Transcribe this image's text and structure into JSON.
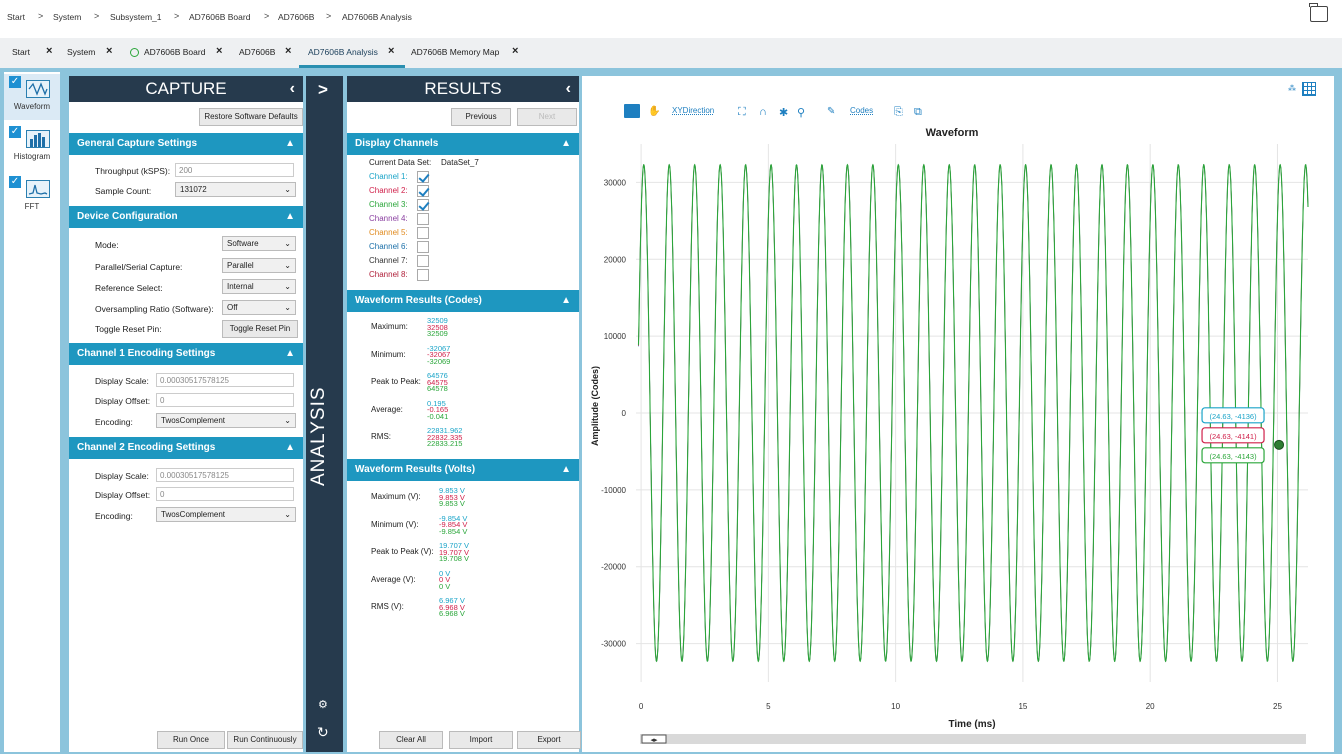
{
  "breadcrumb": [
    "Start",
    "System",
    "Subsystem_1",
    "AD7606B Board",
    "AD7606B",
    "AD7606B Analysis"
  ],
  "tabs": [
    {
      "label": "Start"
    },
    {
      "label": "System"
    },
    {
      "label": "AD7606B Board"
    },
    {
      "label": "AD7606B"
    },
    {
      "label": "AD7606B Analysis"
    },
    {
      "label": "AD7606B Memory Map"
    }
  ],
  "leftnav": [
    {
      "label": "Waveform",
      "icon": "waveform-icon"
    },
    {
      "label": "Histogram",
      "icon": "histogram-icon"
    },
    {
      "label": "FFT",
      "icon": "fft-icon"
    }
  ],
  "capture": {
    "title": "CAPTURE",
    "restore_label": "Restore Software Defaults",
    "general": {
      "title": "General Capture Settings",
      "throughput_label": "Throughput (kSPS):",
      "throughput_value": "200",
      "sample_count_label": "Sample Count:",
      "sample_count_value": "131072"
    },
    "device": {
      "title": "Device Configuration",
      "mode_label": "Mode:",
      "mode_value": "Software",
      "ps_label": "Parallel/Serial Capture:",
      "ps_value": "Parallel",
      "ref_label": "Reference Select:",
      "ref_value": "Internal",
      "osr_label": "Oversampling Ratio (Software):",
      "osr_value": "Off",
      "reset_label": "Toggle Reset Pin:",
      "reset_button": "Toggle Reset Pin"
    },
    "ch1": {
      "title": "Channel 1 Encoding Settings",
      "scale_label": "Display Scale:",
      "scale_value": "0.00030517578125",
      "offset_label": "Display Offset:",
      "offset_value": "0",
      "encoding_label": "Encoding:",
      "encoding_value": "TwosComplement"
    },
    "ch2": {
      "title": "Channel 2 Encoding Settings",
      "scale_label": "Display Scale:",
      "scale_value": "0.00030517578125",
      "offset_label": "Display Offset:",
      "offset_value": "0",
      "encoding_label": "Encoding:",
      "encoding_value": "TwosComplement"
    },
    "run_once": "Run Once",
    "run_continuously": "Run Continuously"
  },
  "analysis": {
    "label": "ANALYSIS",
    "expand": ">"
  },
  "results": {
    "title": "RESULTS",
    "previous": "Previous",
    "next": "Next",
    "display_channels": {
      "title": "Display Channels",
      "dataset_label": "Current Data Set:",
      "dataset_value": "DataSet_7",
      "channels": [
        {
          "label": "Channel 1:",
          "checked": true,
          "color": "#1aa4c8"
        },
        {
          "label": "Channel 2:",
          "checked": true,
          "color": "#d0204a"
        },
        {
          "label": "Channel 3:",
          "checked": true,
          "color": "#2aa63a"
        },
        {
          "label": "Channel 4:",
          "checked": false,
          "color": "#8a3fa0"
        },
        {
          "label": "Channel 5:",
          "checked": false,
          "color": "#e08a1e"
        },
        {
          "label": "Channel 6:",
          "checked": false,
          "color": "#1a6fa8"
        },
        {
          "label": "Channel 7:",
          "checked": false,
          "color": "#333333"
        },
        {
          "label": "Channel 8:",
          "checked": false,
          "color": "#b0203a"
        }
      ]
    },
    "codes": {
      "title": "Waveform Results (Codes)",
      "rows": [
        {
          "label": "Maximum:",
          "v": [
            "32509",
            "32508",
            "32509"
          ]
        },
        {
          "label": "Minimum:",
          "v": [
            "-32067",
            "-32067",
            "-32069"
          ]
        },
        {
          "label": "Peak to Peak:",
          "v": [
            "64576",
            "64575",
            "64578"
          ]
        },
        {
          "label": "Average:",
          "v": [
            "0.195",
            "-0.165",
            "-0.041"
          ]
        },
        {
          "label": "RMS:",
          "v": [
            "22831.962",
            "22832.335",
            "22833.215"
          ]
        }
      ]
    },
    "volts": {
      "title": "Waveform Results (Volts)",
      "rows": [
        {
          "label": "Maximum (V):",
          "v": [
            "9.853 V",
            "9.853 V",
            "9.853 V"
          ]
        },
        {
          "label": "Minimum (V):",
          "v": [
            "-9.854 V",
            "-9.854 V",
            "-9.854 V"
          ]
        },
        {
          "label": "Peak to Peak (V):",
          "v": [
            "19.707 V",
            "19.707 V",
            "19.708 V"
          ]
        },
        {
          "label": "Average (V):",
          "v": [
            "0 V",
            "0 V",
            "0 V"
          ]
        },
        {
          "label": "RMS (V):",
          "v": [
            "6.967 V",
            "6.968 V",
            "6.968 V"
          ]
        }
      ]
    },
    "clear_all": "Clear All",
    "import": "Import",
    "export": "Export"
  },
  "toolbar": {
    "xy_label": "XYDirection",
    "codes_label": "Codes"
  },
  "chart_data": {
    "type": "line",
    "title": "Waveform",
    "xlabel": "Time (ms)",
    "ylabel": "Amplitude (Codes)",
    "xlim": [
      -0.2,
      26.2
    ],
    "ylim": [
      -35000,
      35000
    ],
    "xticks": [
      0,
      5,
      10,
      15,
      20,
      25
    ],
    "yticks": [
      30000,
      20000,
      10000,
      0,
      -10000,
      -20000,
      -30000
    ],
    "grid": true,
    "signal": {
      "amplitude": 32300,
      "frequency_khz": 1.0,
      "x_start": -0.1,
      "x_end": 26.2
    },
    "series": [
      {
        "color": "#1aa4c8"
      },
      {
        "color": "#d0204a"
      },
      {
        "color": "#2aa63a"
      }
    ],
    "cursor_tooltips": [
      {
        "text": "(24.63, -4136)",
        "color": "#1aa4c8"
      },
      {
        "text": "(24.63, -4141)",
        "color": "#d0204a"
      },
      {
        "text": "(24.63, -4143)",
        "color": "#2aa63a"
      }
    ],
    "cursor": {
      "x": 24.63,
      "y": -4141
    }
  }
}
